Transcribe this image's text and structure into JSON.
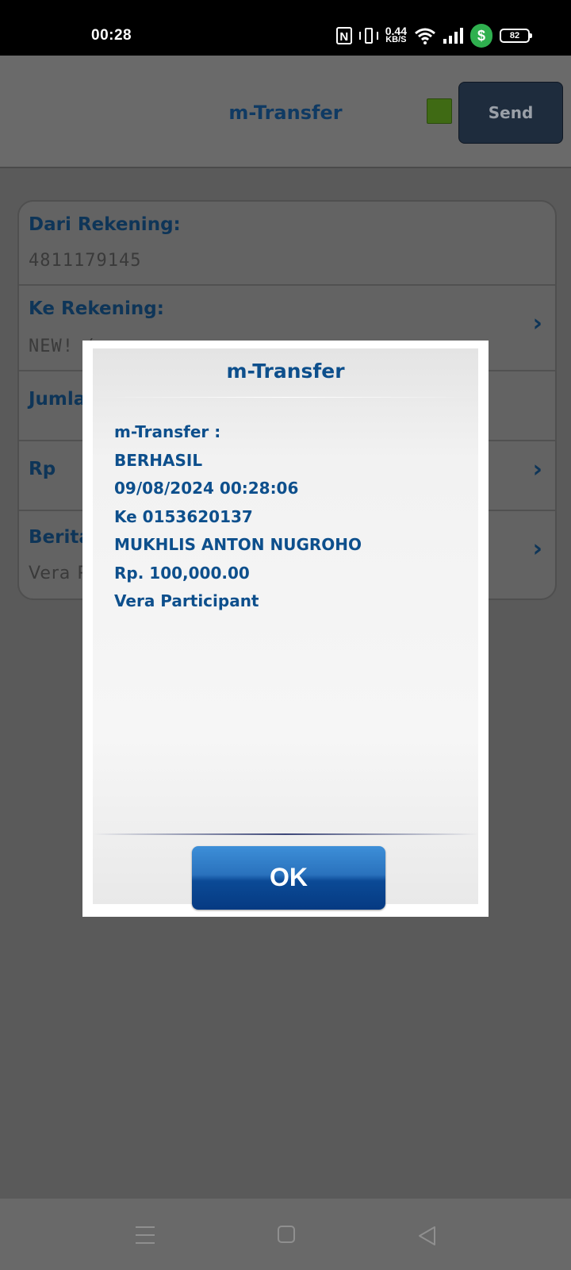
{
  "status_bar": {
    "time": "00:28",
    "nfc_label": "N",
    "net_speed_value": "0.44",
    "net_speed_unit": "KB/S",
    "shield_symbol": "$",
    "battery": "82"
  },
  "header": {
    "title": "m-Transfer",
    "send_label": "Send",
    "indicator_color": "#3f6a14"
  },
  "form": {
    "rows": [
      {
        "label": "Dari Rekening:",
        "value": "4811179145"
      },
      {
        "label": "Ke Rekening:",
        "value": "NEW! (",
        "chevron": "›"
      },
      {
        "label": "Jumla",
        "value": ""
      },
      {
        "label": "Rp",
        "value": "",
        "chevron": "›"
      },
      {
        "label": "Berita",
        "value": "Vera P",
        "chevron": "›"
      }
    ]
  },
  "dialog": {
    "title": "m-Transfer",
    "lines": [
      "m-Transfer :",
      "BERHASIL",
      "09/08/2024 00:28:06",
      "Ke 0153620137",
      "MUKHLIS ANTON NUGROHO",
      "Rp. 100,000.00",
      "Vera Participant"
    ],
    "ok_label": "OK"
  },
  "nav_bar": {
    "menu_icon": "menu-icon",
    "home_icon": "home-icon",
    "back_icon": "back-icon"
  }
}
